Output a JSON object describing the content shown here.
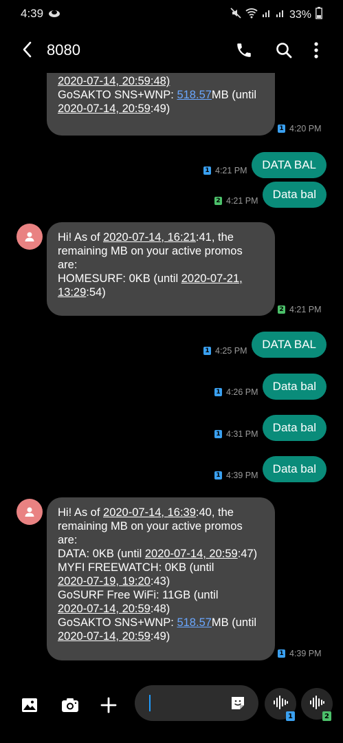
{
  "status_bar": {
    "time": "4:39",
    "battery": "33%"
  },
  "header": {
    "contact": "8080"
  },
  "messages": {
    "m0": {
      "line_partial": "2020-07-14, 20:59:48)",
      "line1a": "GoSAKTO SNS+WNP: ",
      "line1_link": "518.57",
      "line1b": "MB (until",
      "line2": "2020-07-14, 20:59",
      "line2b": ":49)",
      "time": "4:20 PM",
      "sim": "1"
    },
    "o1": {
      "text": "DATA BAL",
      "time": "4:21 PM",
      "sim": "1"
    },
    "o2": {
      "text": "Data bal",
      "time": "4:21 PM",
      "sim": "2"
    },
    "m3": {
      "a": "Hi! As of ",
      "a_u": "2020-07-14, 16:21",
      "a2": ":41, the",
      "b": "remaining MB on your active promos",
      "c": "are:",
      "d": "HOMESURF: 0KB (until ",
      "d_u": "2020-07-21,",
      "e_u": "13:29",
      "e": ":54)",
      "time": "4:21 PM",
      "sim": "2"
    },
    "o4": {
      "text": "DATA BAL",
      "time": "4:25 PM",
      "sim": "1"
    },
    "o5": {
      "text": "Data bal",
      "time": "4:26 PM",
      "sim": "1"
    },
    "o6": {
      "text": "Data bal",
      "time": "4:31 PM",
      "sim": "1"
    },
    "o7": {
      "text": "Data bal",
      "time": "4:39 PM",
      "sim": "1"
    },
    "m8": {
      "a": "Hi! As of ",
      "a_u": "2020-07-14, 16:39",
      "a2": ":40, the",
      "b": "remaining MB on your active promos",
      "c": "are:",
      "d": "DATA: 0KB (until ",
      "d_u": "2020-07-14, 20:59",
      "d2": ":47)",
      "e": "MYFI FREEWATCH: 0KB (until",
      "f_u": "2020-07-19, 19:20",
      "f": ":43)",
      "g": "GoSURF Free WiFi: 11GB (until",
      "h_u": "2020-07-14, 20:59",
      "h": ":48)",
      "i": "GoSAKTO SNS+WNP: ",
      "i_link": "518.57",
      "i2": "MB (until",
      "j_u": "2020-07-14, 20:59",
      "j": ":49)",
      "time": "4:39 PM",
      "sim": "1"
    }
  },
  "composer": {
    "voice_sim_1": "1",
    "voice_sim_2": "2"
  },
  "colors": {
    "outgoing": "#0a8c7a",
    "incoming": "#454545",
    "link": "#6aa7ff",
    "avatar": "#e98282"
  }
}
